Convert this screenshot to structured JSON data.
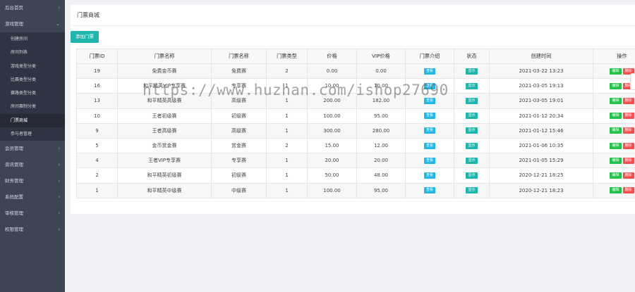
{
  "sidebar": {
    "groups": [
      {
        "label": "后台首页",
        "arrow": "›"
      },
      {
        "label": "游戏管理",
        "arrow": "⌄"
      },
      {
        "label": "会员管理",
        "arrow": "›"
      },
      {
        "label": "资讯管理",
        "arrow": "›"
      },
      {
        "label": "财务管理",
        "arrow": "›"
      },
      {
        "label": "系统配置",
        "arrow": "›"
      },
      {
        "label": "审核管理",
        "arrow": "›"
      },
      {
        "label": "权限管理",
        "arrow": "›"
      }
    ],
    "sub_items": [
      "创建房间",
      "房间列表",
      "游戏类型分类",
      "比赛类型分类",
      "赛路类型分类",
      "房间赛制分类",
      "门票商城",
      "参与者管理"
    ]
  },
  "main": {
    "title": "门票商城",
    "add_button": "添加门票",
    "columns": [
      "门票ID",
      "门票名称",
      "门票名称",
      "门票类型",
      "价格",
      "VIP价格",
      "门票介绍",
      "状态",
      "创建时间",
      "操作"
    ],
    "view_label": "查看",
    "show_label": "显示",
    "edit_label": "编辑",
    "delete_label": "删除",
    "rows": [
      {
        "id": "19",
        "name": "免费金币赛",
        "category": "免费赛",
        "type": "2",
        "price": "0.00",
        "vip_price": "0.00",
        "created": "2021-03-22 13:23"
      },
      {
        "id": "16",
        "name": "和平精英VIP专享赛",
        "category": "专享赛",
        "type": "1",
        "price": "10.00",
        "vip_price": "10.00",
        "created": "2021-03-05 19:13"
      },
      {
        "id": "13",
        "name": "和平精英高级赛",
        "category": "高级赛",
        "type": "1",
        "price": "200.00",
        "vip_price": "182.00",
        "created": "2021-03-05 19:01"
      },
      {
        "id": "10",
        "name": "王者初级赛",
        "category": "初级赛",
        "type": "1",
        "price": "100.00",
        "vip_price": "95.00",
        "created": "2021-01-12 20:34"
      },
      {
        "id": "9",
        "name": "王者高级赛",
        "category": "高级赛",
        "type": "1",
        "price": "300.00",
        "vip_price": "280.00",
        "created": "2021-01-12 15:46"
      },
      {
        "id": "5",
        "name": "金币赏金赛",
        "category": "赏金赛",
        "type": "2",
        "price": "15.00",
        "vip_price": "12.00",
        "created": "2021-01-06 10:35"
      },
      {
        "id": "4",
        "name": "王者VIP专享赛",
        "category": "专享赛",
        "type": "1",
        "price": "20.00",
        "vip_price": "20.00",
        "created": "2021-01-05 15:29"
      },
      {
        "id": "2",
        "name": "和平精英初级赛",
        "category": "初级赛",
        "type": "1",
        "price": "50.00",
        "vip_price": "48.00",
        "created": "2020-12-21 18:25"
      },
      {
        "id": "1",
        "name": "和平精英中级赛",
        "category": "中级赛",
        "type": "1",
        "price": "100.00",
        "vip_price": "95.00",
        "created": "2020-12-21 18:23"
      }
    ]
  },
  "watermark": "https://www.huzhan.com/ishop27690",
  "colors": {
    "sidebar": "#3d4454",
    "sub_bg": "#2e3441",
    "teal": "#1fb5ac",
    "blue": "#23b7e5",
    "green": "#27c24c",
    "red": "#f05050"
  }
}
